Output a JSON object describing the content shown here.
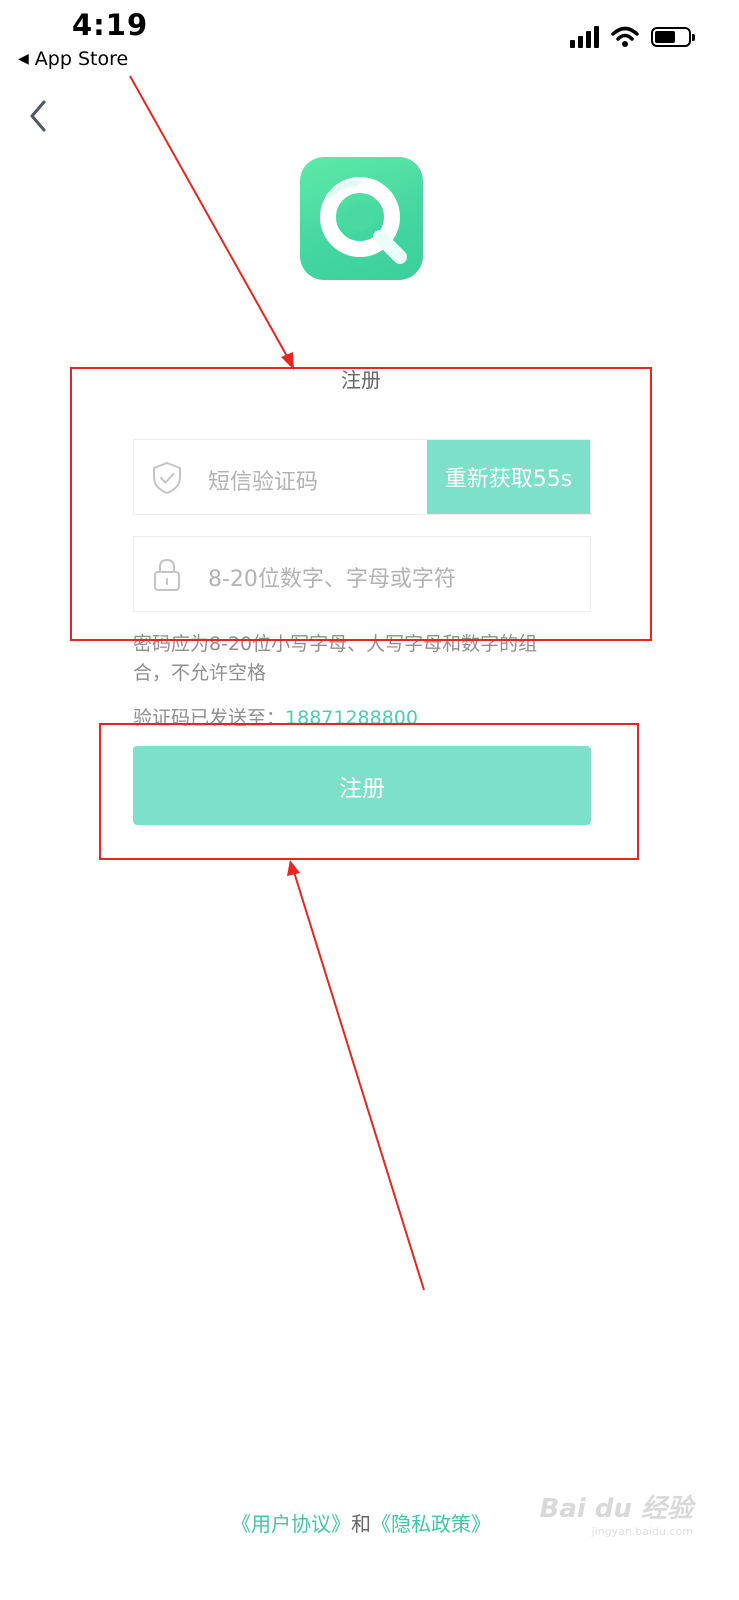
{
  "status_bar": {
    "time": "4:19",
    "back_app": "App Store",
    "back_glyph": "◀"
  },
  "page": {
    "heading": "注册"
  },
  "form": {
    "code_placeholder": "短信验证码",
    "resend_label": "重新获取55s",
    "password_placeholder": "8-20位数字、字母或字符",
    "password_hint": "密码应为8-20位小写字母、大写字母和数字的组合，不允许空格",
    "sent_to_label": "验证码已发送至：",
    "sent_to_phone": "18871288800",
    "submit_label": "注册"
  },
  "footer": {
    "user_agreement": "《用户协议》",
    "and": "和",
    "privacy_policy": "《隐私政策》"
  },
  "watermark": {
    "brand": "Bai du 经验",
    "url": "jingyan.baidu.com"
  },
  "colors": {
    "accent": "#7de0c9",
    "link": "#3fc8a3",
    "annotation": "#e8251e"
  },
  "icons": [
    "back-chevron-icon",
    "signal-icon",
    "wifi-icon",
    "battery-icon",
    "shield-check-icon",
    "lock-icon",
    "app-logo-icon"
  ]
}
